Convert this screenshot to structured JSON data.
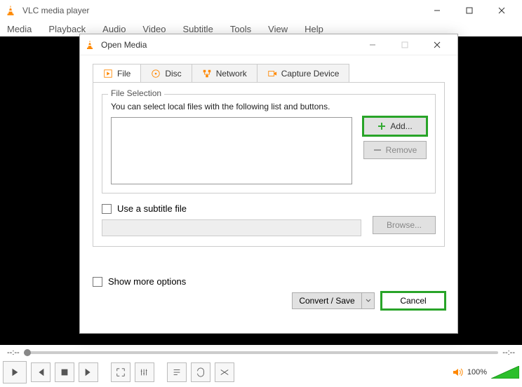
{
  "main_window": {
    "title": "VLC media player",
    "menu": [
      "Media",
      "Playback",
      "Audio",
      "Video",
      "Subtitle",
      "Tools",
      "View",
      "Help"
    ]
  },
  "dialog": {
    "title": "Open Media",
    "tabs": {
      "file": "File",
      "disc": "Disc",
      "network": "Network",
      "capture": "Capture Device"
    },
    "file_selection": {
      "legend": "File Selection",
      "hint": "You can select local files with the following list and buttons.",
      "add_label": "Add...",
      "remove_label": "Remove"
    },
    "subtitle": {
      "checkbox_label": "Use a subtitle file",
      "browse_label": "Browse..."
    },
    "show_more_label": "Show more options",
    "convert_save_label": "Convert / Save",
    "cancel_label": "Cancel"
  },
  "player": {
    "time_left": "--:--",
    "time_right": "--:--",
    "volume_text": "100%"
  }
}
